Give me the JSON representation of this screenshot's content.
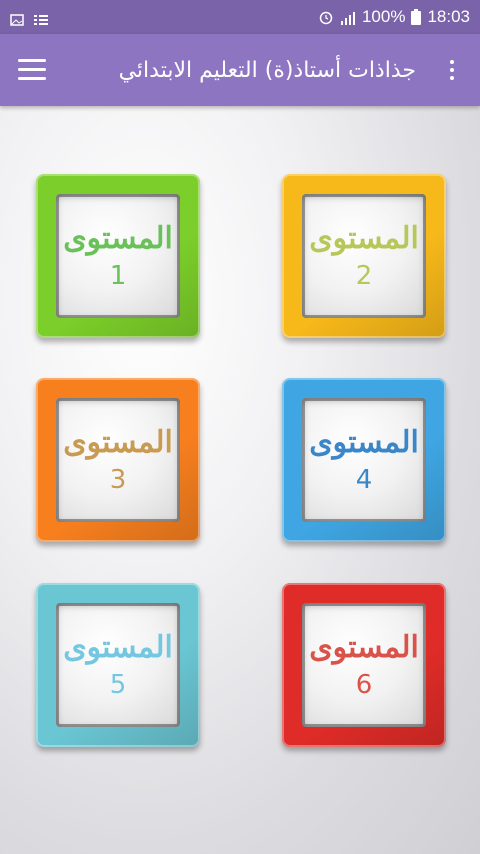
{
  "status_bar": {
    "battery": "100%",
    "time": "18:03"
  },
  "app_bar": {
    "title": "جذاذات أستاذ(ة) التعليم الابتدائي",
    "menu_icon": "hamburger-menu-icon",
    "overflow_icon": "more-vert-icon"
  },
  "levels": [
    {
      "word": "المستوى",
      "number": "1",
      "frame_color": "#7ccf2a",
      "text_color": "#6ac15a",
      "num_color": "#6ac15a"
    },
    {
      "word": "المستوى",
      "number": "2",
      "frame_color": "#f7b81a",
      "text_color": "#b8c75a",
      "num_color": "#b8c75a"
    },
    {
      "word": "المستوى",
      "number": "3",
      "frame_color": "#f77f1e",
      "text_color": "#c89a52",
      "num_color": "#c89a52"
    },
    {
      "word": "المستوى",
      "number": "4",
      "frame_color": "#3fa6e3",
      "text_color": "#3a86c8",
      "num_color": "#3a86c8"
    },
    {
      "word": "المستوى",
      "number": "5",
      "frame_color": "#6ac6d3",
      "text_color": "#74c7e0",
      "num_color": "#74c7e0"
    },
    {
      "word": "المستوى",
      "number": "6",
      "frame_color": "#e02c28",
      "text_color": "#d9534a",
      "num_color": "#d9534a"
    }
  ]
}
